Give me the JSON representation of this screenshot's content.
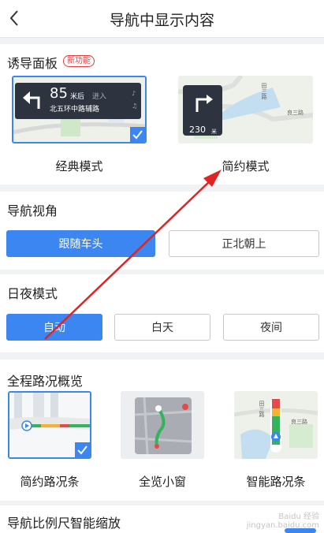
{
  "header": {
    "title": "导航中显示内容"
  },
  "guide_panel": {
    "title": "诱导面板",
    "badge": "新功能",
    "options": [
      {
        "label": "经典模式",
        "distance": "85",
        "unit": "米后",
        "action": "进入",
        "road": "北五环中路辅路",
        "selected": true
      },
      {
        "label": "简约模式",
        "distance": "230",
        "unit": "米",
        "selected": false
      }
    ]
  },
  "view_angle": {
    "title": "导航视角",
    "options": [
      {
        "label": "跟随车头",
        "active": true
      },
      {
        "label": "正北朝上",
        "active": false
      }
    ]
  },
  "day_night": {
    "title": "日夜模式",
    "options": [
      {
        "label": "自动",
        "active": true
      },
      {
        "label": "白天",
        "active": false
      },
      {
        "label": "夜间",
        "active": false
      }
    ]
  },
  "overview": {
    "title": "全程路况概览",
    "options": [
      {
        "label": "简约路况条",
        "selected": true
      },
      {
        "label": "全览小窗",
        "selected": false
      },
      {
        "label": "智能路况条",
        "selected": false
      }
    ]
  },
  "map_labels": {
    "road_a": "良三路",
    "road_b": "田三路"
  },
  "scale": {
    "title": "导航比例尺智能缩放"
  },
  "watermark": {
    "line1": "Baidu 经验",
    "line2": "jingyan.baidu.com"
  },
  "colors": {
    "accent": "#3b86f0",
    "arrow": "#e02424",
    "badge": "#e23a3a"
  }
}
